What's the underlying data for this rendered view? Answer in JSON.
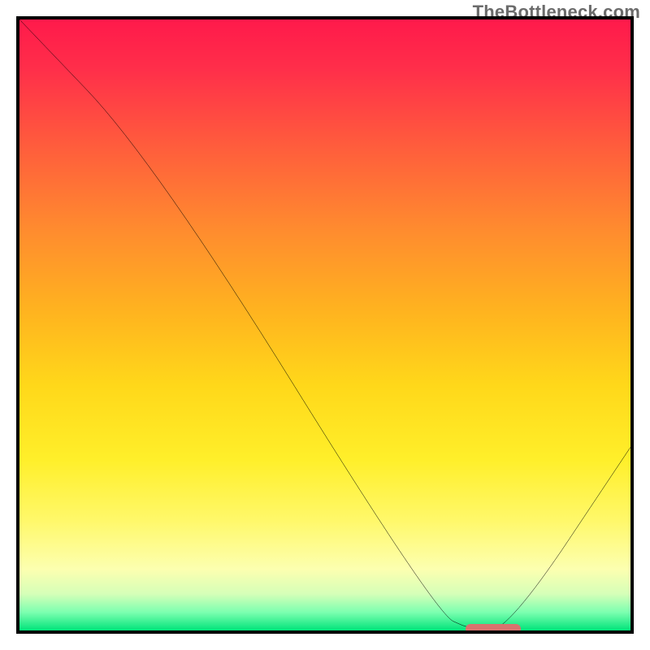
{
  "watermark": "TheBottleneck.com",
  "chart_data": {
    "type": "line",
    "title": "",
    "xlabel": "",
    "ylabel": "",
    "xlim": [
      0,
      100
    ],
    "ylim": [
      0,
      100
    ],
    "series": [
      {
        "name": "bottleneck-curve",
        "x": [
          0,
          22,
          68,
          74,
          80,
          100
        ],
        "y": [
          100,
          77,
          3,
          0,
          0,
          30
        ]
      }
    ],
    "optimal_marker": {
      "x_start": 73,
      "x_end": 82,
      "y": 0
    },
    "gradient_stops": [
      {
        "pct": 0,
        "color": "#ff1a4b"
      },
      {
        "pct": 8,
        "color": "#ff2e4a"
      },
      {
        "pct": 20,
        "color": "#ff5a3d"
      },
      {
        "pct": 34,
        "color": "#ff8a2f"
      },
      {
        "pct": 48,
        "color": "#ffb41f"
      },
      {
        "pct": 60,
        "color": "#ffd81a"
      },
      {
        "pct": 72,
        "color": "#ffef2a"
      },
      {
        "pct": 82,
        "color": "#fff86a"
      },
      {
        "pct": 90,
        "color": "#fcffb0"
      },
      {
        "pct": 94,
        "color": "#d6ffb8"
      },
      {
        "pct": 97,
        "color": "#7dffb0"
      },
      {
        "pct": 100,
        "color": "#00e47a"
      }
    ]
  }
}
